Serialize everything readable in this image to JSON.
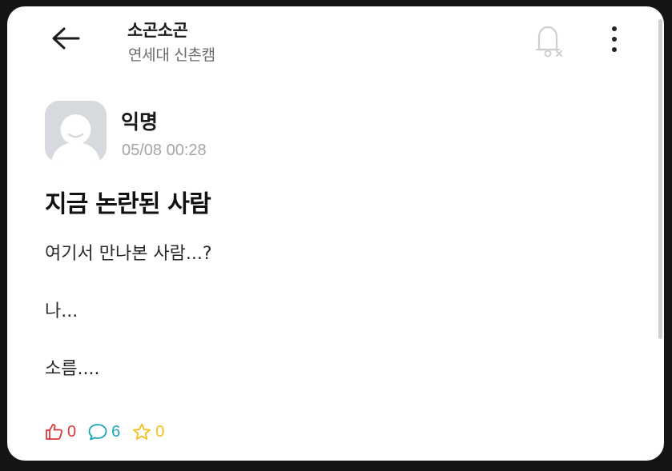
{
  "header": {
    "board_title": "소곤소곤",
    "school_name": "연세대 신촌캠",
    "icons": {
      "back": "back-arrow-icon",
      "notification": "notification-off-icon",
      "more": "more-vertical-icon"
    }
  },
  "post": {
    "author": "익명",
    "timestamp": "05/08 00:28",
    "title": "지금 논란된 사람",
    "body_lines": [
      "여기서 만나본 사람...?",
      "나...",
      "소름...."
    ]
  },
  "stats": {
    "likes": "0",
    "comments": "6",
    "scraps": "0",
    "colors": {
      "like": "#e0363a",
      "comment": "#1aa6b7",
      "scrap": "#f2bd1d"
    }
  }
}
